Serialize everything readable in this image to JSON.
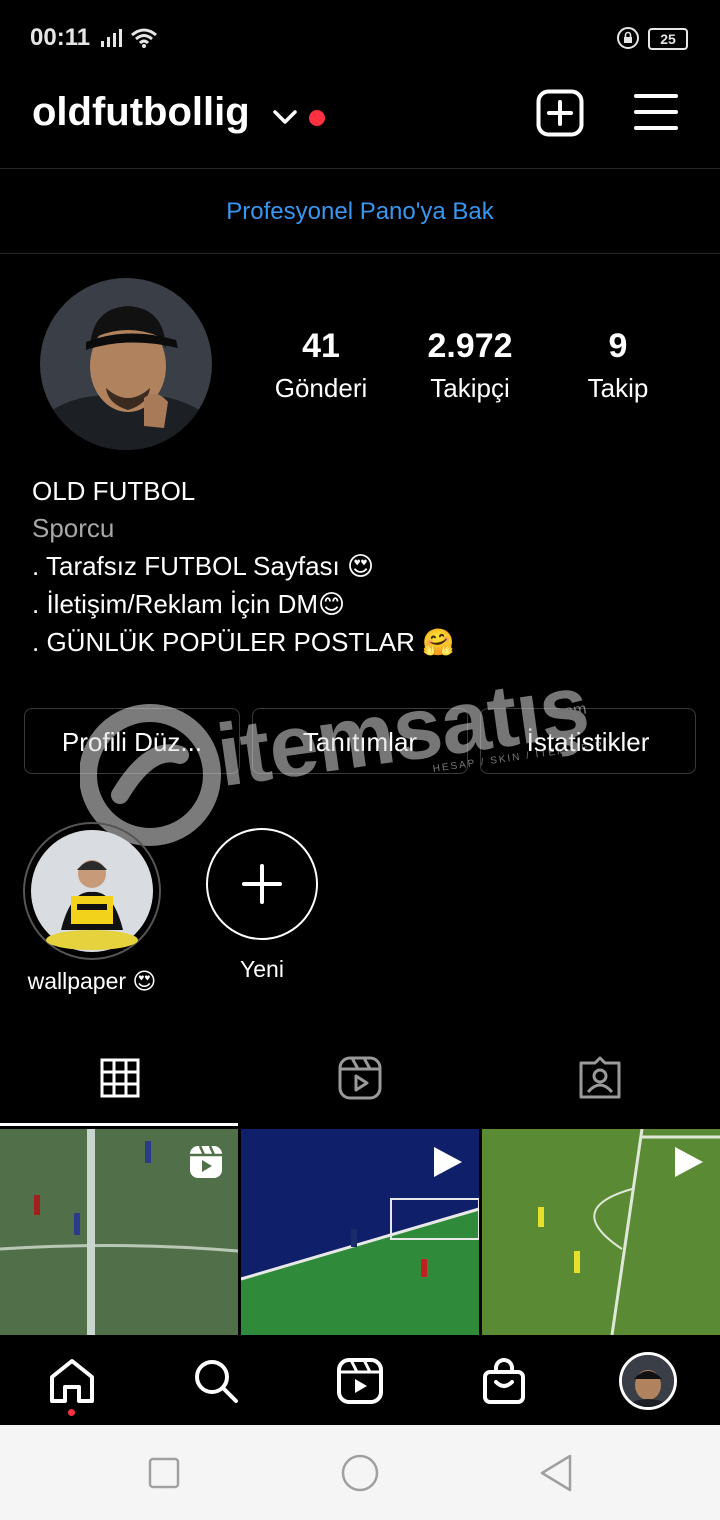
{
  "status": {
    "time": "00:11",
    "battery": "25"
  },
  "header": {
    "username": "oldfutbollig"
  },
  "pro_dashboard": {
    "label": "Profesyonel Pano'ya Bak"
  },
  "stats": [
    {
      "value": "41",
      "label": "Gönderi"
    },
    {
      "value": "2.972",
      "label": "Takipçi"
    },
    {
      "value": "9",
      "label": "Takip"
    }
  ],
  "bio": {
    "name": "OLD FUTBOL",
    "category": "Sporcu",
    "lines": [
      ". Tarafsız FUTBOL Sayfası 😍",
      ". İletişim/Reklam İçin DM😊",
      ". GÜNLÜK POPÜLER POSTLAR 🤗"
    ]
  },
  "buttons": {
    "edit": "Profili Düz...",
    "promotions": "Tanıtımlar",
    "insights": "İstatistikler"
  },
  "highlights": [
    {
      "label": "wallpaper 😍"
    },
    {
      "label": "Yeni"
    }
  ],
  "watermark": {
    "brand": "itemsatış",
    "domain": ".com",
    "tagline": "HESAP / SKIN / İTEM / E-PIN"
  },
  "icons": {
    "header": [
      "chevron-down-icon",
      "notification-dot",
      "new-post-icon",
      "menu-icon"
    ],
    "tabs": [
      "grid-icon",
      "reels-icon",
      "tagged-icon"
    ],
    "nav": [
      "home-icon",
      "search-icon",
      "reels-icon",
      "shop-icon",
      "profile-avatar"
    ],
    "system": [
      "recent-apps-icon",
      "home-circle-icon",
      "back-icon"
    ]
  },
  "colors": {
    "accent": "#3897f0",
    "notification": "#ff3040",
    "background": "#000000"
  }
}
